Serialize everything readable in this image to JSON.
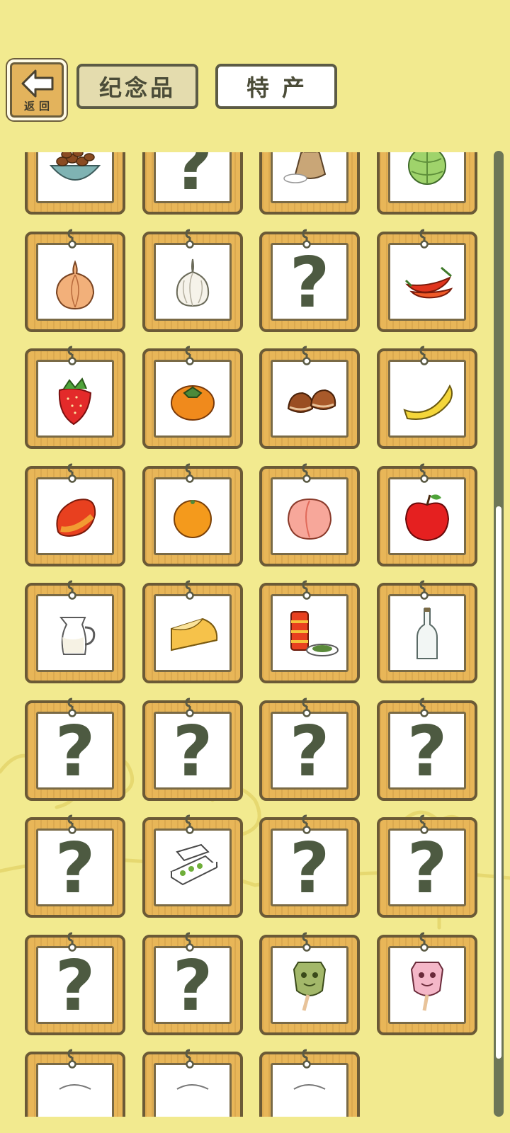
{
  "header": {
    "back_label": "返回",
    "tabs": [
      {
        "label": "纪念品",
        "selected": true
      },
      {
        "label": "特产",
        "selected": false
      }
    ]
  },
  "grid": {
    "columns": 4,
    "items": [
      {
        "name": "nuts-bowl",
        "icon": "nuts-bowl-icon",
        "unknown": false
      },
      {
        "name": "unknown",
        "unknown": true,
        "label": "?"
      },
      {
        "name": "rice-sack",
        "icon": "rice-sack-icon",
        "unknown": false
      },
      {
        "name": "cabbage",
        "icon": "cabbage-icon",
        "unknown": false
      },
      {
        "name": "onion",
        "icon": "onion-icon",
        "unknown": false
      },
      {
        "name": "garlic",
        "icon": "garlic-icon",
        "unknown": false
      },
      {
        "name": "unknown",
        "unknown": true,
        "label": "?"
      },
      {
        "name": "chili",
        "icon": "chili-icon",
        "unknown": false
      },
      {
        "name": "strawberry",
        "icon": "strawberry-icon",
        "unknown": false
      },
      {
        "name": "persimmon",
        "icon": "persimmon-icon",
        "unknown": false
      },
      {
        "name": "chestnut",
        "icon": "chestnut-icon",
        "unknown": false
      },
      {
        "name": "banana",
        "icon": "banana-icon",
        "unknown": false
      },
      {
        "name": "mango",
        "icon": "mango-icon",
        "unknown": false
      },
      {
        "name": "orange",
        "icon": "orange-icon",
        "unknown": false
      },
      {
        "name": "peach",
        "icon": "peach-icon",
        "unknown": false
      },
      {
        "name": "apple",
        "icon": "apple-icon",
        "unknown": false
      },
      {
        "name": "milk",
        "icon": "milk-jug-icon",
        "unknown": false
      },
      {
        "name": "cheese",
        "icon": "cheese-icon",
        "unknown": false
      },
      {
        "name": "tea-can",
        "icon": "tea-can-icon",
        "unknown": false
      },
      {
        "name": "bottle",
        "icon": "bottle-icon",
        "unknown": false
      },
      {
        "name": "unknown",
        "unknown": true,
        "label": "?"
      },
      {
        "name": "unknown",
        "unknown": true,
        "label": "?"
      },
      {
        "name": "unknown",
        "unknown": true,
        "label": "?"
      },
      {
        "name": "unknown",
        "unknown": true,
        "label": "?"
      },
      {
        "name": "unknown",
        "unknown": true,
        "label": "?"
      },
      {
        "name": "bento",
        "icon": "bento-box-icon",
        "unknown": false
      },
      {
        "name": "unknown",
        "unknown": true,
        "label": "?"
      },
      {
        "name": "unknown",
        "unknown": true,
        "label": "?"
      },
      {
        "name": "unknown",
        "unknown": true,
        "label": "?"
      },
      {
        "name": "unknown",
        "unknown": true,
        "label": "?"
      },
      {
        "name": "green-mask-candy",
        "icon": "green-mask-candy-icon",
        "unknown": false
      },
      {
        "name": "pink-mask-candy",
        "icon": "pink-mask-candy-icon",
        "unknown": false
      },
      {
        "name": "partial-1",
        "icon": "partial-item-icon",
        "unknown": false
      },
      {
        "name": "partial-2",
        "icon": "partial-item-icon",
        "unknown": false
      },
      {
        "name": "partial-3",
        "icon": "partial-item-icon",
        "unknown": false
      }
    ]
  },
  "scroll": {
    "position": 0.37,
    "visible_fraction": 0.57
  }
}
